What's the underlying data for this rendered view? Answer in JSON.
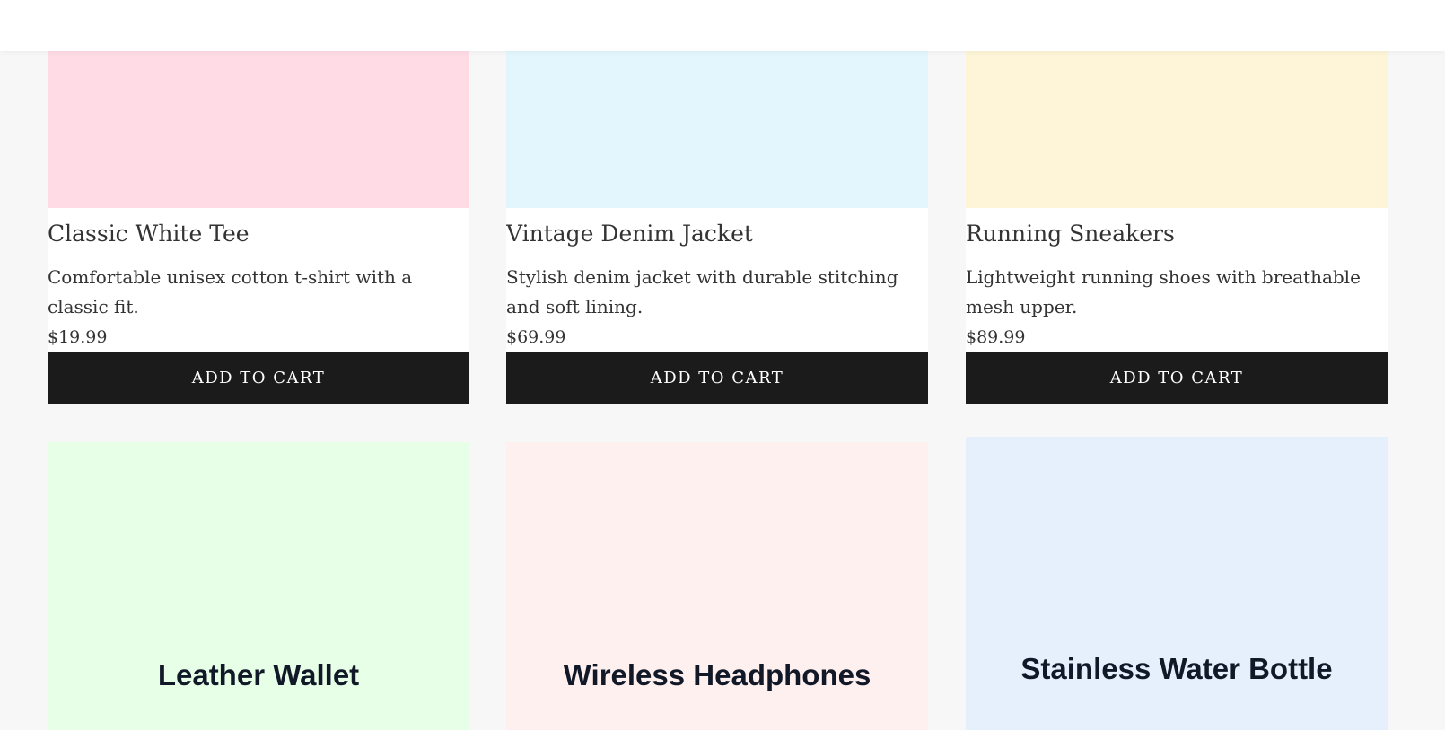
{
  "products": [
    {
      "name": "Classic White Tee",
      "description": "Comfortable unisex cotton t-shirt with a classic fit.",
      "price": "$19.99",
      "cta": "ADD TO CART",
      "image_color": "#ffdbe5"
    },
    {
      "name": "Vintage Denim Jacket",
      "description": "Stylish denim jacket with durable stitching and soft lining.",
      "price": "$69.99",
      "cta": "ADD TO CART",
      "image_color": "#e3f5fd"
    },
    {
      "name": "Running Sneakers",
      "description": "Lightweight running shoes with breathable mesh upper.",
      "price": "$89.99",
      "cta": "ADD TO CART",
      "image_color": "#fef4d7"
    },
    {
      "name": "Leather Wallet",
      "image_color": "#e6ffe6"
    },
    {
      "name": "Wireless Headphones",
      "image_color": "#fef0ef"
    },
    {
      "name": "Stainless Water Bottle",
      "image_color": "#e6f0fd"
    }
  ],
  "colors": {
    "page_background": "#f7f7f7",
    "button_background": "#1b1b1b",
    "button_text": "#ffffff",
    "text": "#333333"
  }
}
